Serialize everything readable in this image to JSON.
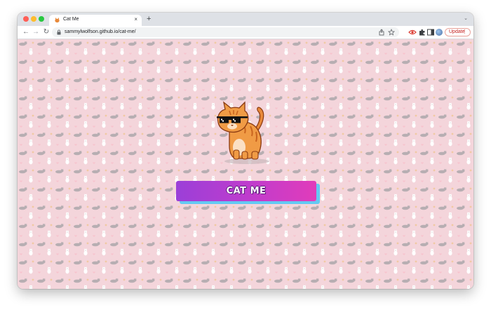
{
  "browser": {
    "tab": {
      "title": "Cat Me",
      "close_glyph": "×"
    },
    "new_tab_glyph": "+",
    "tab_menu_glyph": "⌄",
    "toolbar": {
      "back_glyph": "←",
      "forward_glyph": "→",
      "reload_glyph": "↻",
      "url": "sammylwolfson.github.io/cat-me/",
      "update_label": "Update",
      "update_menu_glyph": "⋮"
    },
    "colors": {
      "tab_strip": "#dee1e6",
      "update_accent": "#c5221f"
    }
  },
  "page": {
    "cat_button_label": "CAT ME",
    "cat_description": "orange-tabby-cat-with-pixel-sunglasses",
    "colors": {
      "background": "#f4d5db",
      "button_gradient_start": "#9b3fd8",
      "button_gradient_end": "#e13cba",
      "button_shadow": "#63c9f2"
    }
  }
}
